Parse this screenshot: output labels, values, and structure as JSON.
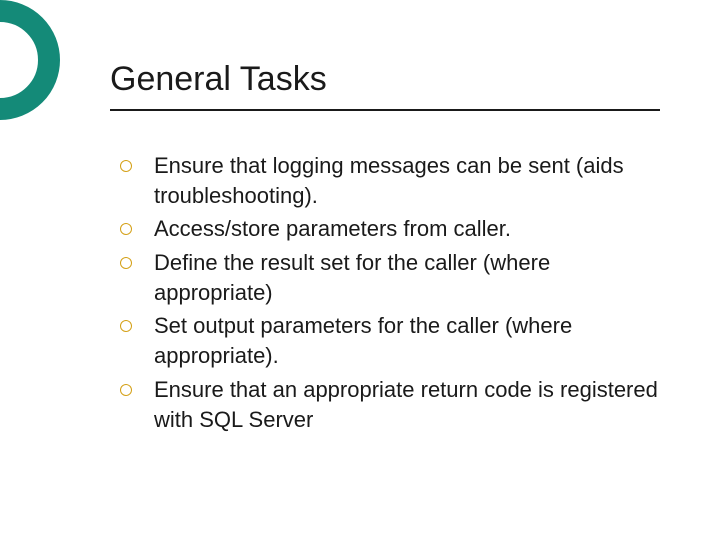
{
  "slide": {
    "title": "General Tasks",
    "bullets": [
      {
        "text": "Ensure that logging messages can be sent (aids troubleshooting)."
      },
      {
        "text": "Access/store parameters from caller."
      },
      {
        "text": "Define the result set for the caller (where appropriate)"
      },
      {
        "text": "Set output parameters for the caller (where appropriate)."
      },
      {
        "text": "Ensure that an appropriate return code is registered with SQL Server"
      }
    ]
  }
}
